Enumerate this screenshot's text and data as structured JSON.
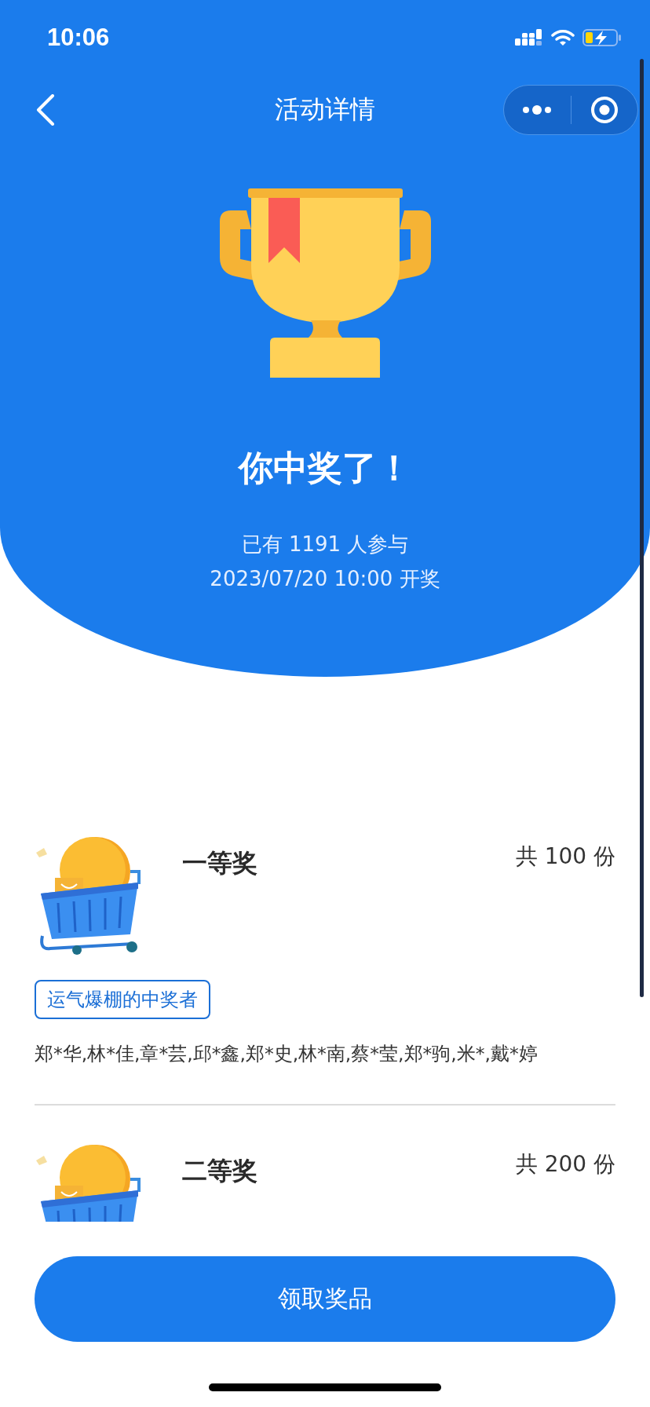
{
  "status_bar": {
    "time": "10:06"
  },
  "nav": {
    "title": "活动详情"
  },
  "result": {
    "headline": "你中奖了！",
    "participants": "已有 1191 人参与",
    "draw_time": "2023/07/20 10:00 开奖"
  },
  "prizes": [
    {
      "name": "一等奖",
      "count": "共 100 份",
      "winners_tag": "运气爆棚的中奖者",
      "winners": "郑*华,林*佳,章*芸,邱*鑫,郑*史,林*南,蔡*莹,郑*驹,米*,戴*婷"
    },
    {
      "name": "二等奖",
      "count": "共 200 份"
    }
  ],
  "claim_button": "领取奖品"
}
